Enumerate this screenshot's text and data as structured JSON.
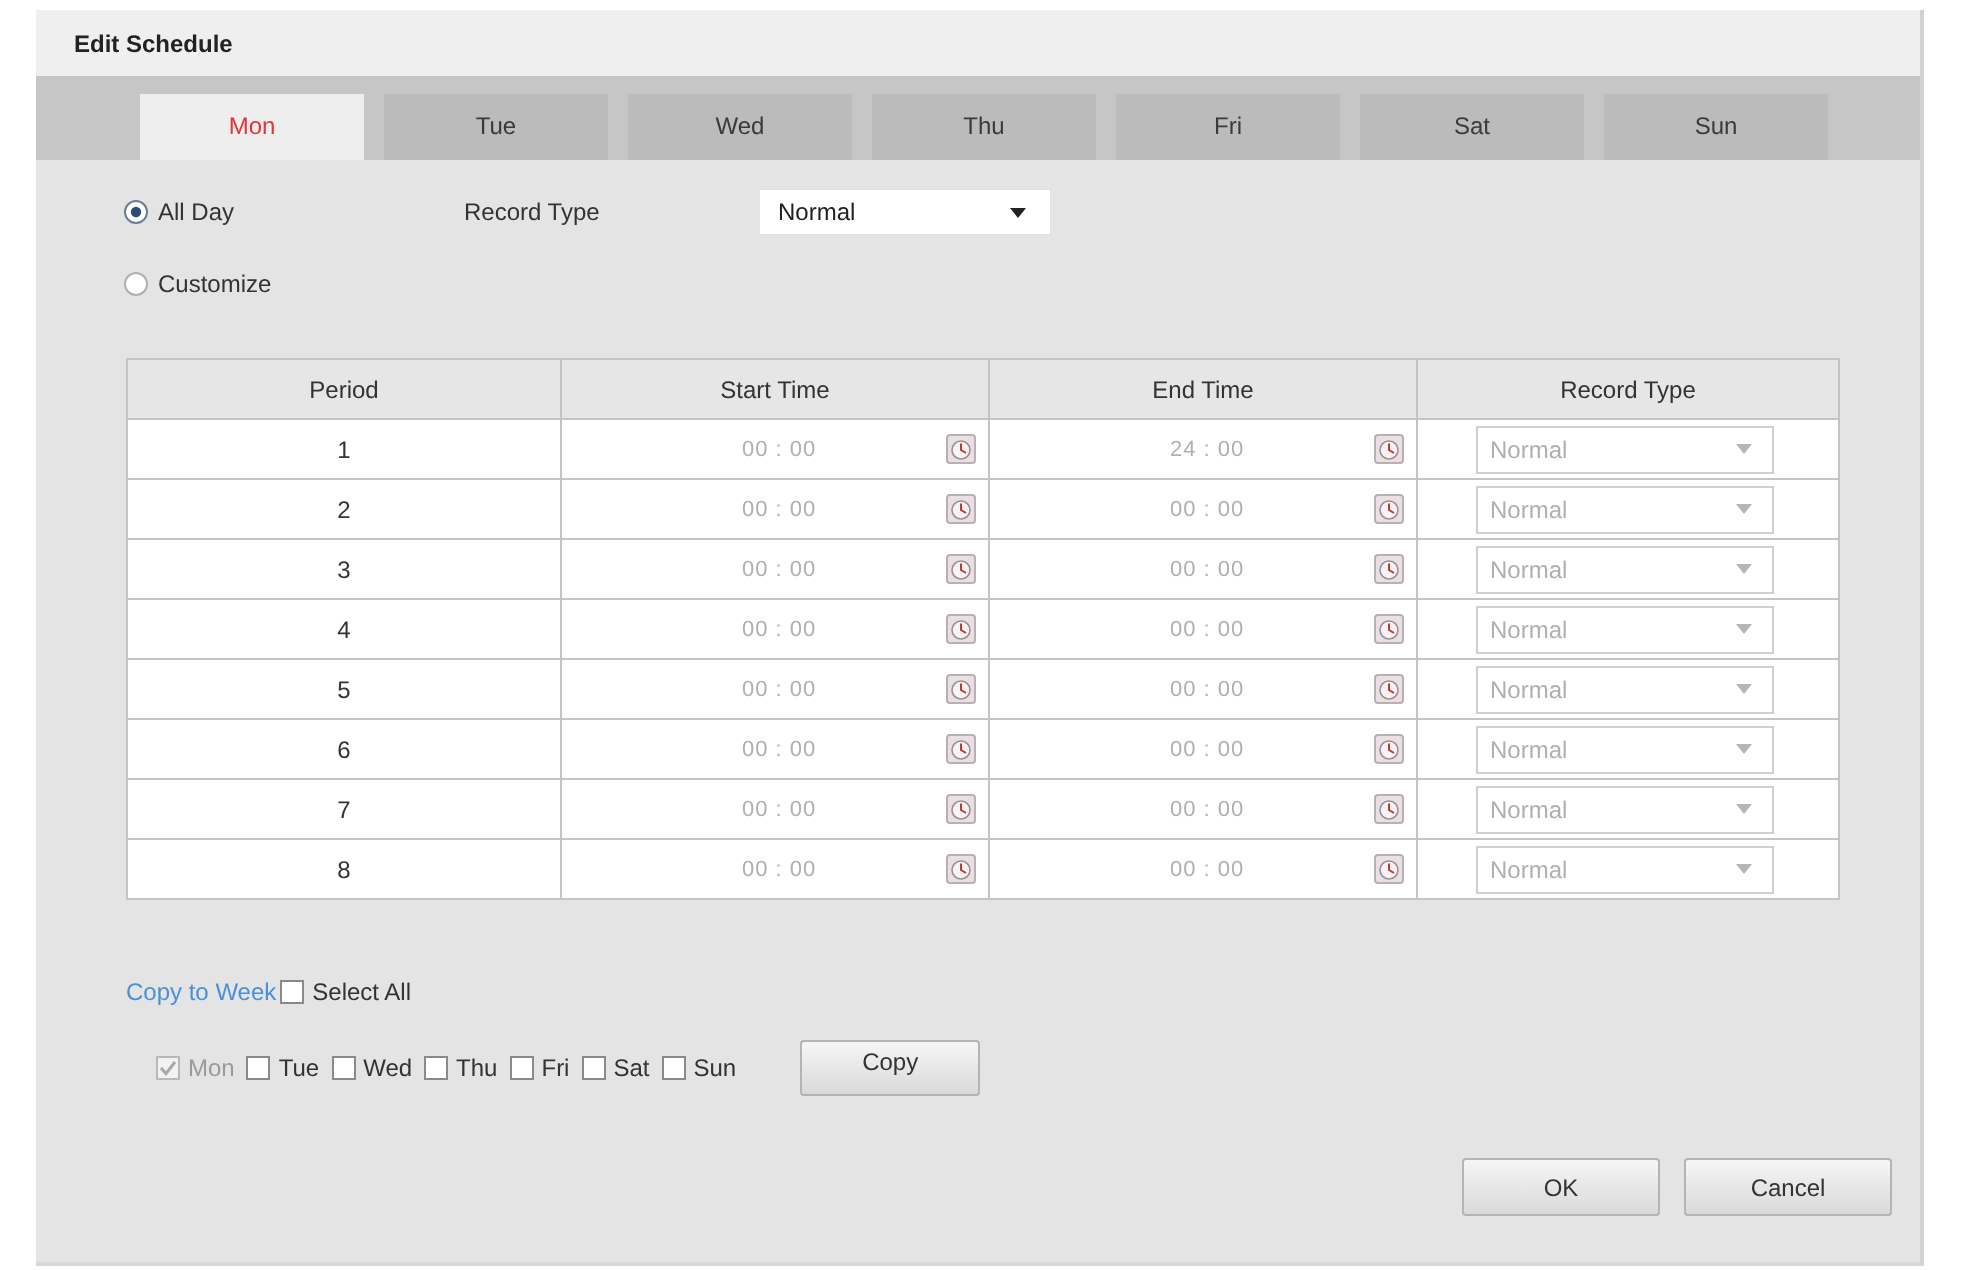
{
  "window": {
    "title": "Edit Schedule"
  },
  "tabs": [
    {
      "label": "Mon",
      "selected": true
    },
    {
      "label": "Tue",
      "selected": false
    },
    {
      "label": "Wed",
      "selected": false
    },
    {
      "label": "Thu",
      "selected": false
    },
    {
      "label": "Fri",
      "selected": false
    },
    {
      "label": "Sat",
      "selected": false
    },
    {
      "label": "Sun",
      "selected": false
    }
  ],
  "mode_options": [
    {
      "label": "All Day",
      "selected": true
    },
    {
      "label": "Customize",
      "selected": false
    }
  ],
  "record_type": {
    "label": "Record Type",
    "value": "Normal"
  },
  "table": {
    "disabled": true,
    "columns": [
      "Period",
      "Start Time",
      "End Time",
      "Record Type"
    ],
    "rows": [
      {
        "period": "1",
        "start": "00 : 00",
        "end": "24 : 00",
        "record_type": "Normal"
      },
      {
        "period": "2",
        "start": "00 : 00",
        "end": "00 : 00",
        "record_type": "Normal"
      },
      {
        "period": "3",
        "start": "00 : 00",
        "end": "00 : 00",
        "record_type": "Normal"
      },
      {
        "period": "4",
        "start": "00 : 00",
        "end": "00 : 00",
        "record_type": "Normal"
      },
      {
        "period": "5",
        "start": "00 : 00",
        "end": "00 : 00",
        "record_type": "Normal"
      },
      {
        "period": "6",
        "start": "00 : 00",
        "end": "00 : 00",
        "record_type": "Normal"
      },
      {
        "period": "7",
        "start": "00 : 00",
        "end": "00 : 00",
        "record_type": "Normal"
      },
      {
        "period": "8",
        "start": "00 : 00",
        "end": "00 : 00",
        "record_type": "Normal"
      }
    ]
  },
  "copy": {
    "link": "Copy to Week",
    "select_all": {
      "label": "Select All",
      "checked": false
    },
    "days": [
      {
        "label": "Mon",
        "checked": true,
        "disabled": true
      },
      {
        "label": "Tue",
        "checked": false,
        "disabled": false
      },
      {
        "label": "Wed",
        "checked": false,
        "disabled": false
      },
      {
        "label": "Thu",
        "checked": false,
        "disabled": false
      },
      {
        "label": "Fri",
        "checked": false,
        "disabled": false
      },
      {
        "label": "Sat",
        "checked": false,
        "disabled": false
      },
      {
        "label": "Sun",
        "checked": false,
        "disabled": false
      }
    ],
    "button": "Copy"
  },
  "buttons": [
    "OK",
    "Cancel"
  ]
}
